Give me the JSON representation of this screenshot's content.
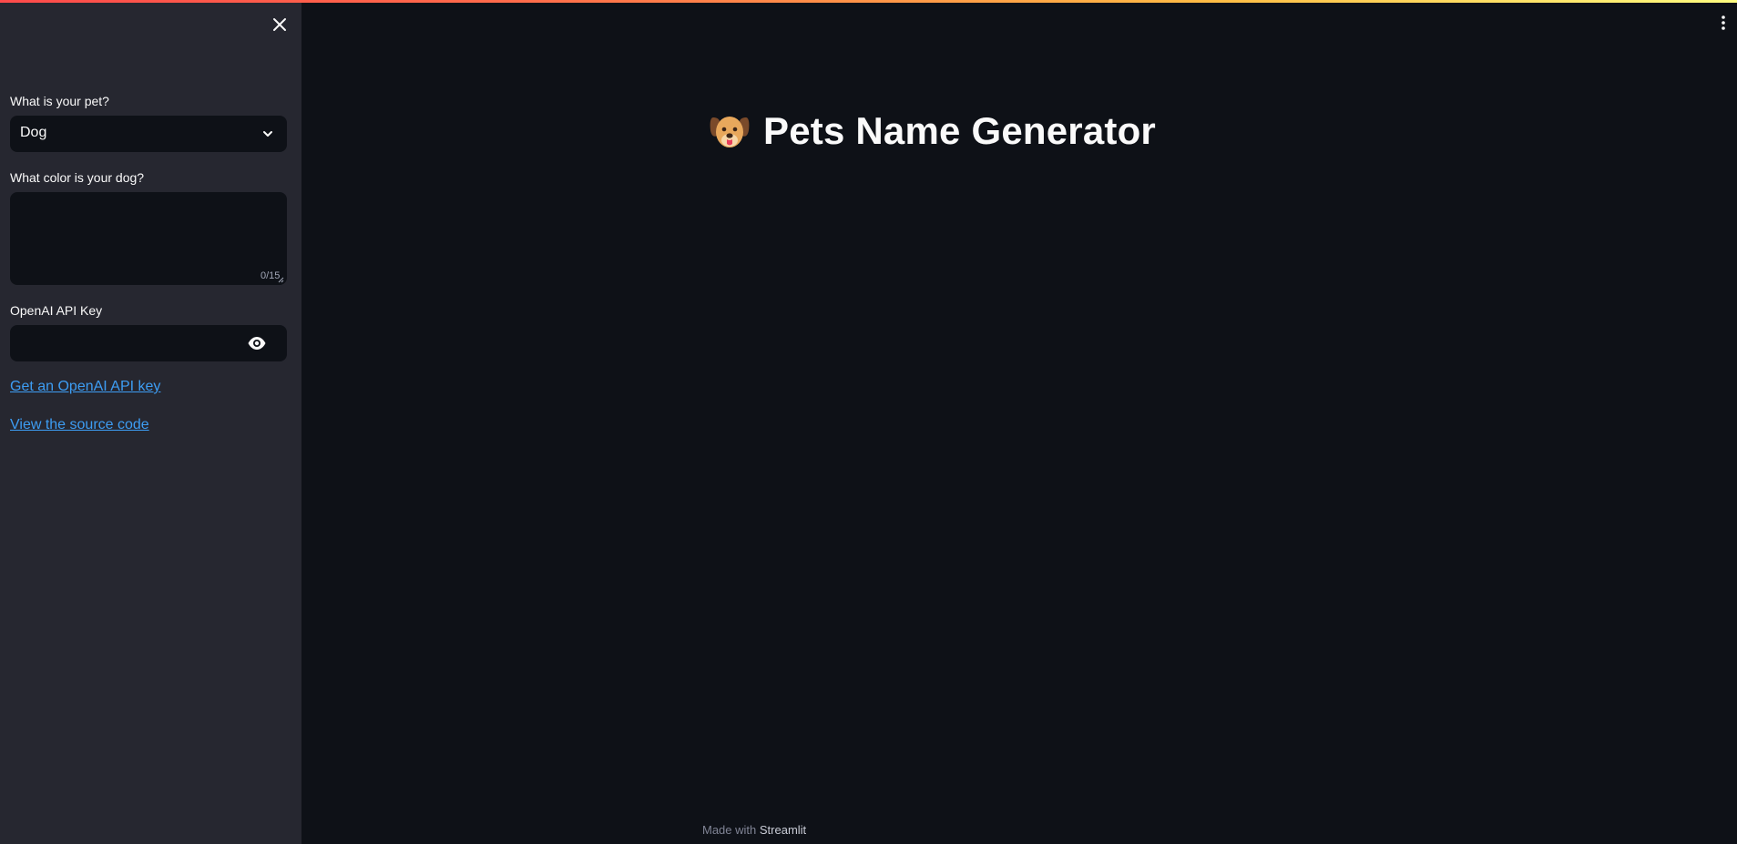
{
  "sidebar": {
    "pet_label": "What is your pet?",
    "pet_selected": "Dog",
    "color_label": "What color is your dog?",
    "color_value": "",
    "color_counter": "0/15",
    "api_key_label": "OpenAI API Key",
    "api_key_value": "",
    "links": [
      {
        "label": "Get an OpenAI API key"
      },
      {
        "label": "View the source code"
      }
    ]
  },
  "main": {
    "title": "Pets Name Generator",
    "title_icon": "dog-face-icon"
  },
  "footer": {
    "prefix": "Made with",
    "brand": "Streamlit"
  },
  "colors": {
    "background": "#0e1117",
    "sidebar": "#262730",
    "link": "#3d9df3",
    "text": "#fafafa"
  }
}
